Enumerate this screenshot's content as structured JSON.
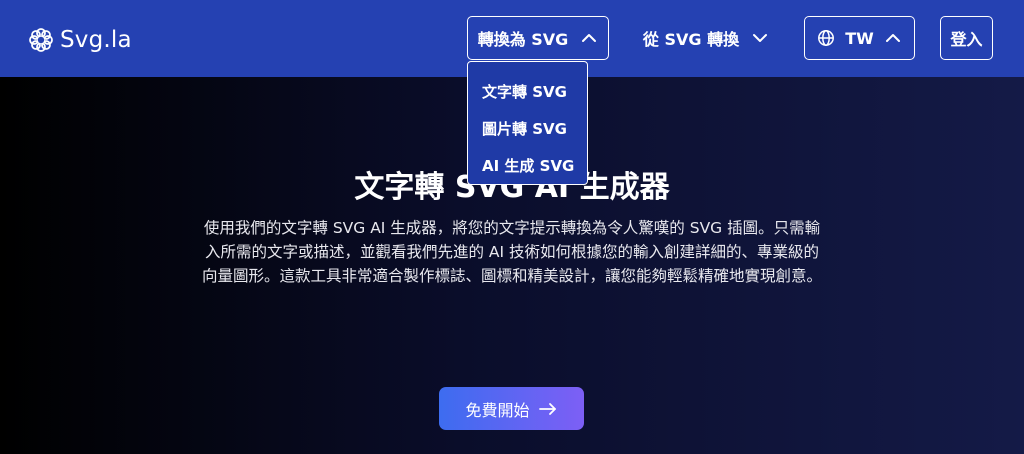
{
  "header": {
    "logo_text": "Svg.la",
    "convert_to_label": "轉換為 SVG",
    "convert_from_label": "從 SVG 轉換",
    "lang_label": "TW",
    "login_label": "登入"
  },
  "dropdown": {
    "items": [
      "文字轉 SVG",
      "圖片轉 SVG",
      "AI 生成 SVG"
    ]
  },
  "hero": {
    "title": "文字轉 SVG AI 生成器",
    "description": "使用我們的文字轉 SVG AI 生成器，將您的文字提示轉換為令人驚嘆的 SVG 插圖。只需輸入所需的文字或描述，並觀看我們先進的 AI 技術如何根據您的輸入創建詳細的、專業級的向量圖形。這款工具非常適合製作標誌、圖標和精美設計，讓您能夠輕鬆精確地實現創意。",
    "cta_label": "免費開始"
  },
  "colors": {
    "navbar": "#2541b2",
    "dropdown_bg": "#1f3aa6",
    "cta_start": "#3d6cf0",
    "cta_end": "#7d5ff5"
  },
  "icons": {
    "logo": "flower-logo-icon",
    "convert_to": "chevron-up-icon",
    "convert_from": "chevron-down-icon",
    "lang_globe": "globe-icon",
    "lang_chevron": "chevron-up-icon",
    "cta": "arrow-right-icon"
  }
}
